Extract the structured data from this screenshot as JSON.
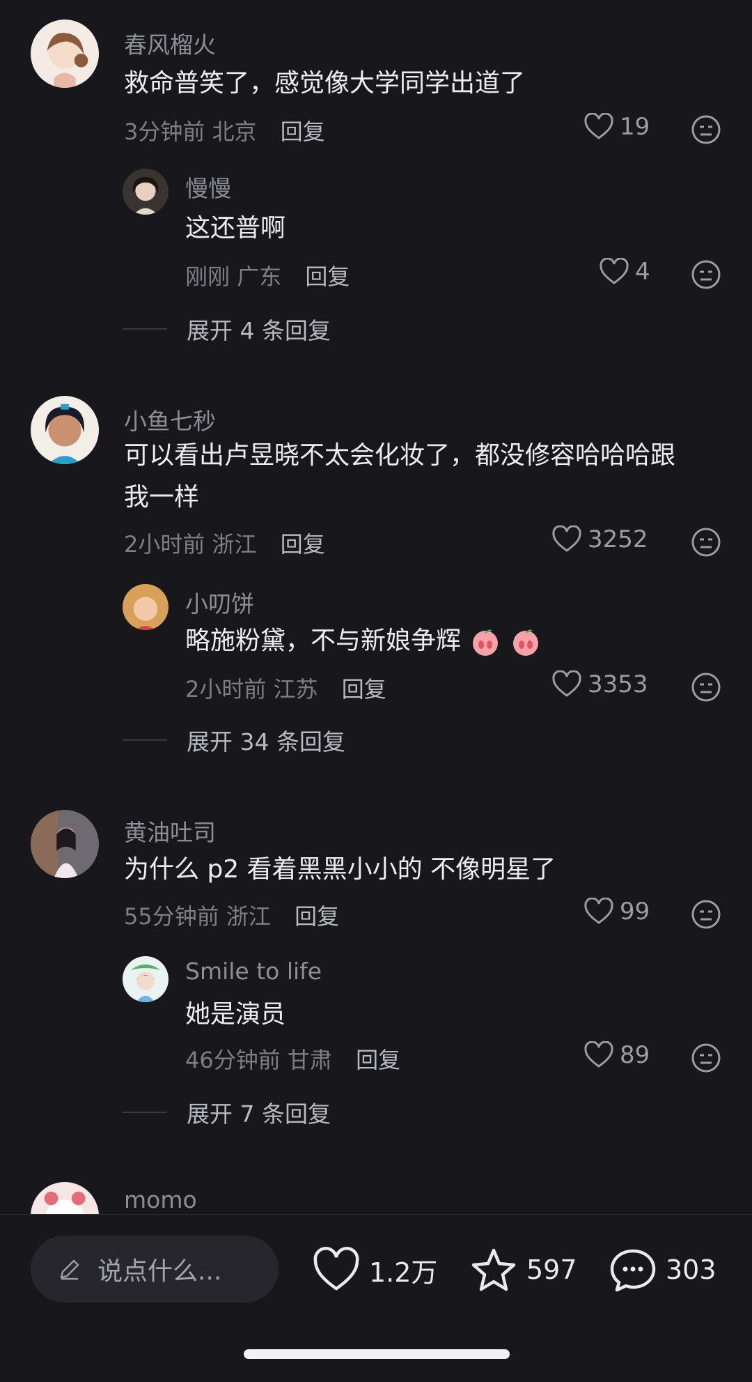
{
  "comments": [
    {
      "name": "春风榴火",
      "text": [
        "救命普笑了，感觉像大学同学出道了"
      ],
      "time": "3分钟前",
      "location": "北京",
      "reply_label": "回复",
      "likes": "19",
      "reply": {
        "name": "慢慢",
        "text": "这还普啊",
        "time": "刚刚",
        "location": "广东",
        "reply_label": "回复",
        "likes": "4"
      },
      "expand_label": "展开 4 条回复"
    },
    {
      "name": "小鱼七秒",
      "text": [
        "可以看出卢昱晓不太会化妆了，都没修容哈哈哈跟",
        "我一样"
      ],
      "time": "2小时前",
      "location": "浙江",
      "reply_label": "回复",
      "likes": "3252",
      "reply": {
        "name": "小叨饼",
        "text": "略施粉黛，不与新娘争辉",
        "time": "2小时前",
        "location": "江苏",
        "reply_label": "回复",
        "likes": "3353"
      },
      "expand_label": "展开 34 条回复"
    },
    {
      "name": "黄油吐司",
      "text": [
        "为什么 p2 看着黑黑小小的 不像明星了"
      ],
      "time": "55分钟前",
      "location": "浙江",
      "reply_label": "回复",
      "likes": "99",
      "reply": {
        "name": "Smile to life",
        "text": "她是演员",
        "time": "46分钟前",
        "location": "甘肃",
        "reply_label": "回复",
        "likes": "89"
      },
      "expand_label": "展开 7 条回复"
    },
    {
      "name": "momo"
    }
  ],
  "bottom_bar": {
    "input_placeholder": "说点什么...",
    "likes": "1.2万",
    "stars": "597",
    "comments": "303"
  },
  "colors": {
    "background": "#17171c",
    "text": "#ececf1",
    "meta": "#7e7e86"
  }
}
